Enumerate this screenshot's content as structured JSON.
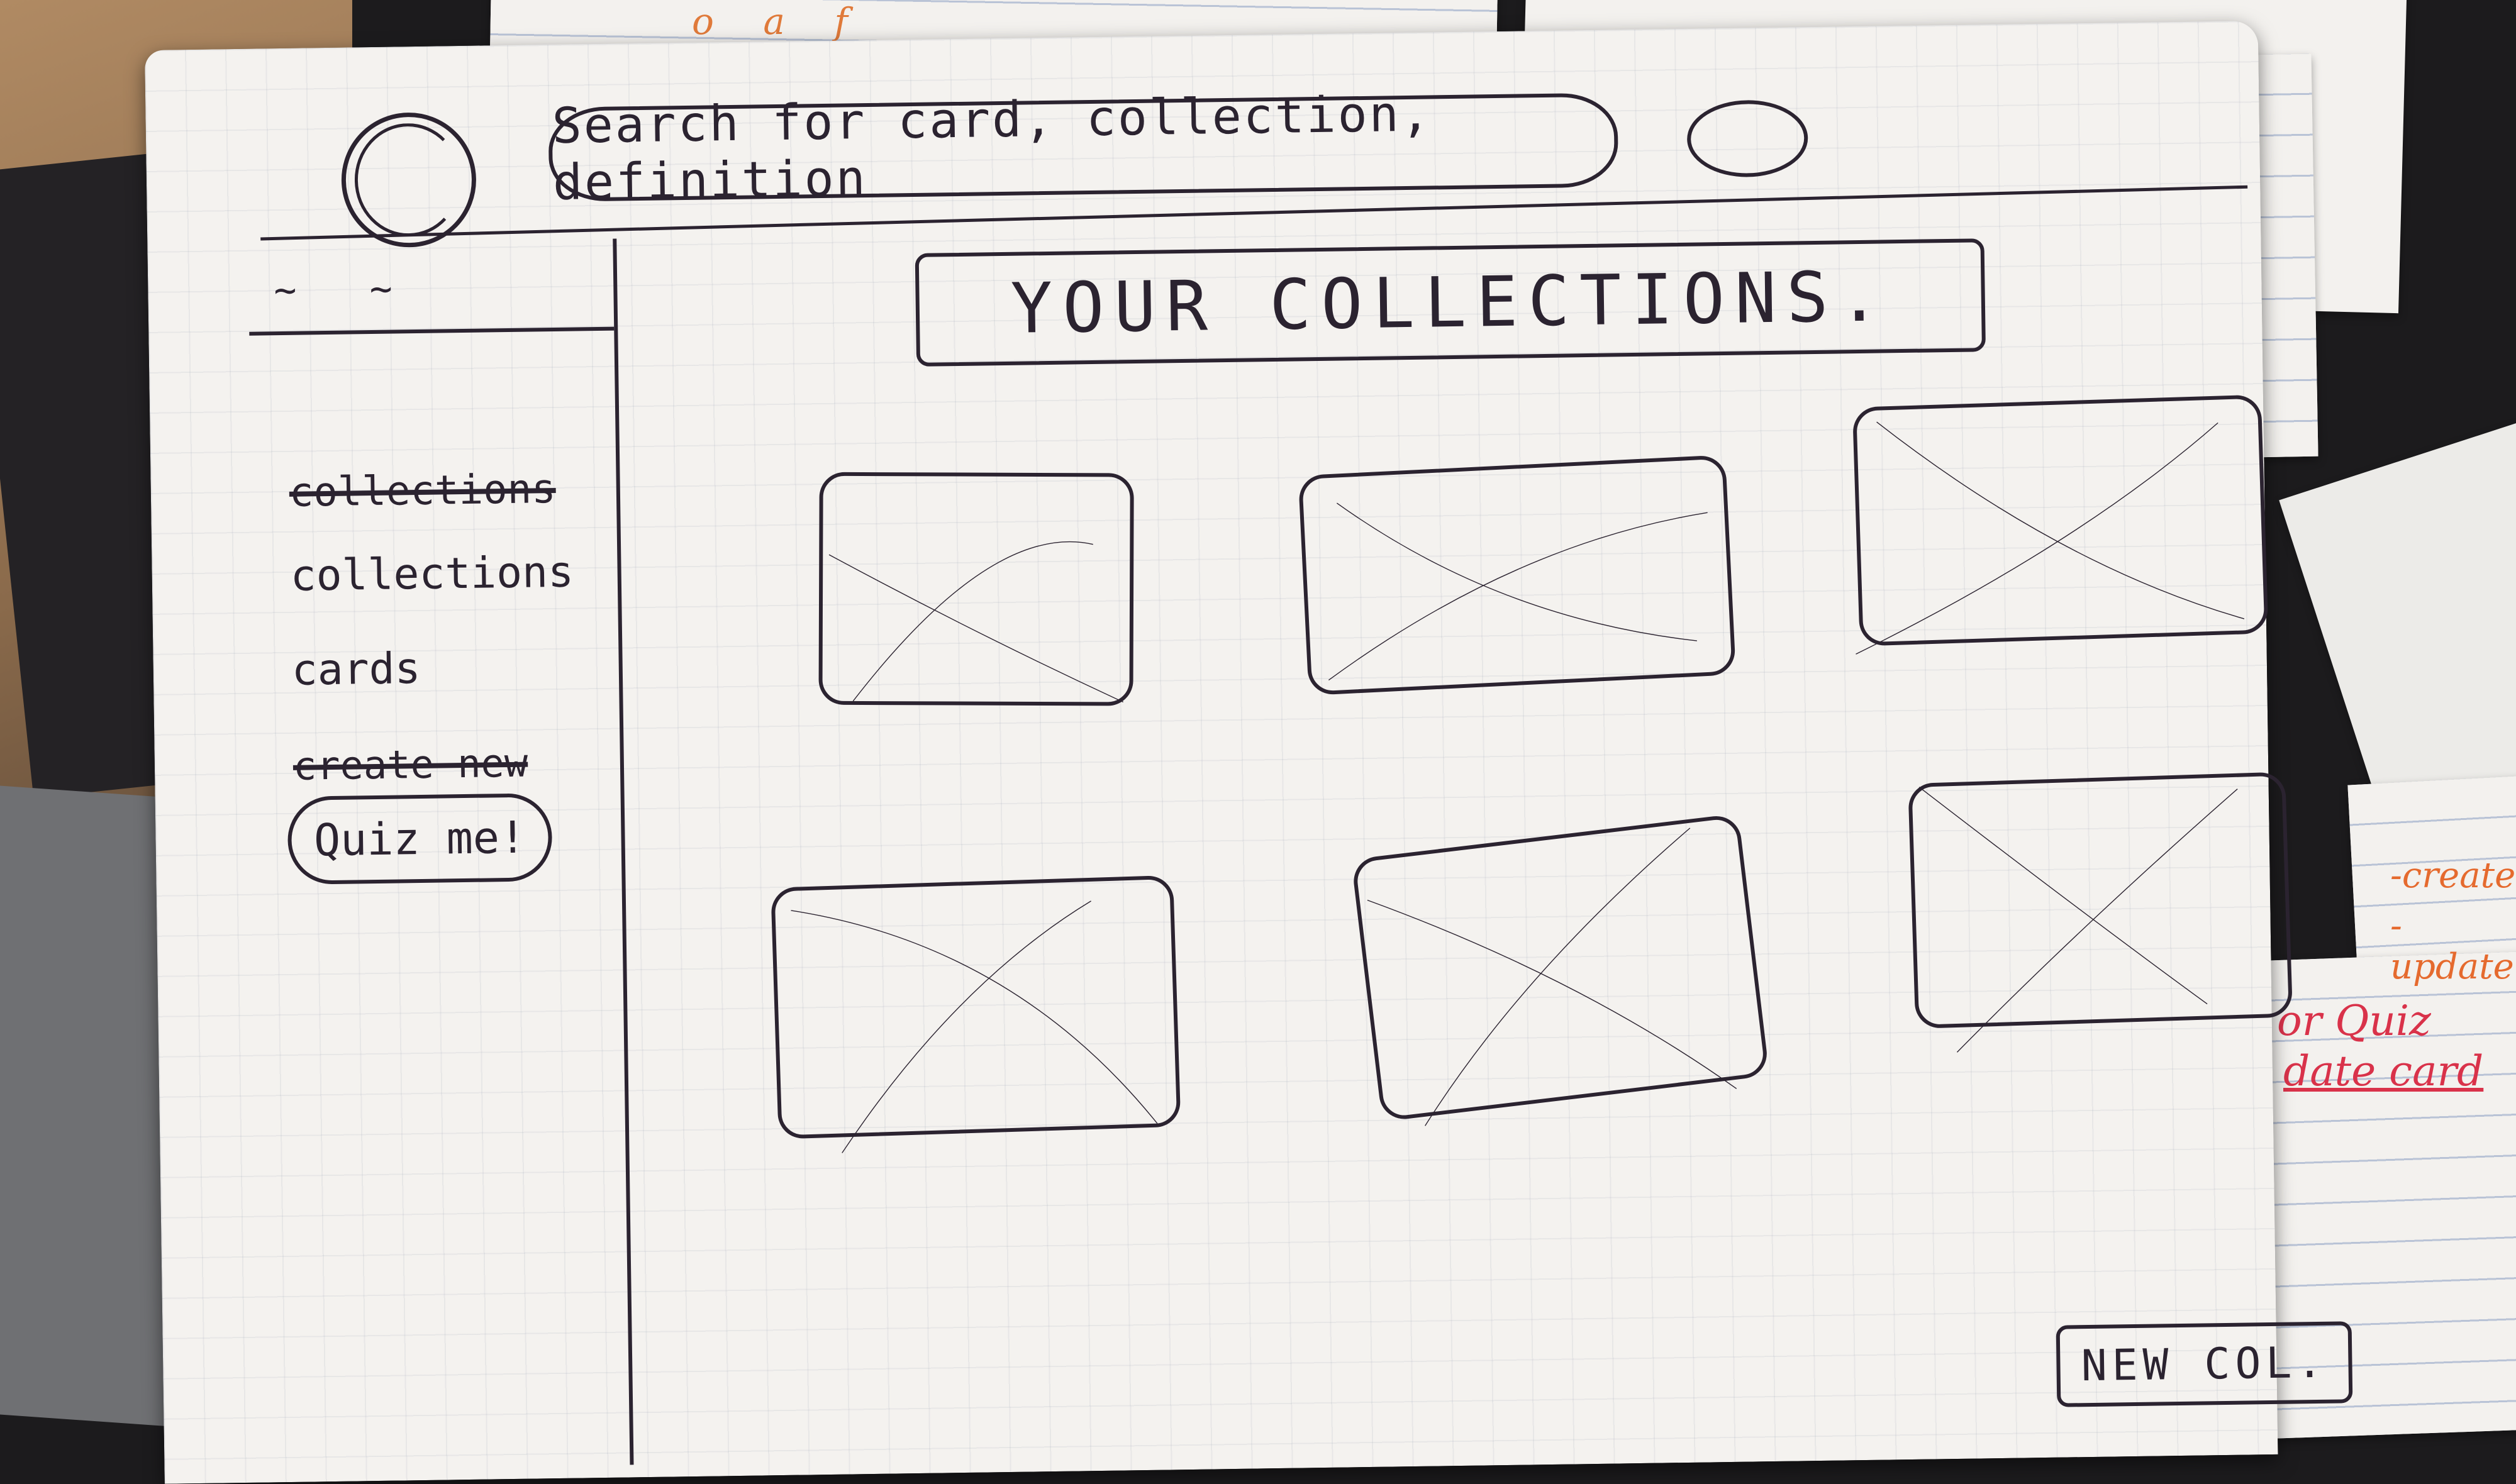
{
  "header": {
    "search_placeholder": "Search for card, collection, definition"
  },
  "sidebar": {
    "menu_toggle": "~ ~",
    "items": [
      {
        "label": "collections",
        "struck_out": true
      },
      {
        "label": "collections",
        "struck_out": false
      },
      {
        "label": "cards",
        "struck_out": false
      },
      {
        "label": "create new",
        "struck_out": true
      },
      {
        "label": "Quiz me!",
        "struck_out": false
      }
    ]
  },
  "main": {
    "title": "YOUR COLLECTIONS.",
    "collections_count": 6,
    "new_button_label": "NEW COL."
  },
  "background_notes": {
    "top_card": "o a f",
    "side_lines": [
      "-create",
      "-update"
    ],
    "quiz_line": "or Quiz",
    "update_line": "date card"
  },
  "colors": {
    "ink": "#2b2330",
    "paper": "#f4f2ef",
    "orange_note": "#e56a2e",
    "red_note": "#d9324a"
  }
}
